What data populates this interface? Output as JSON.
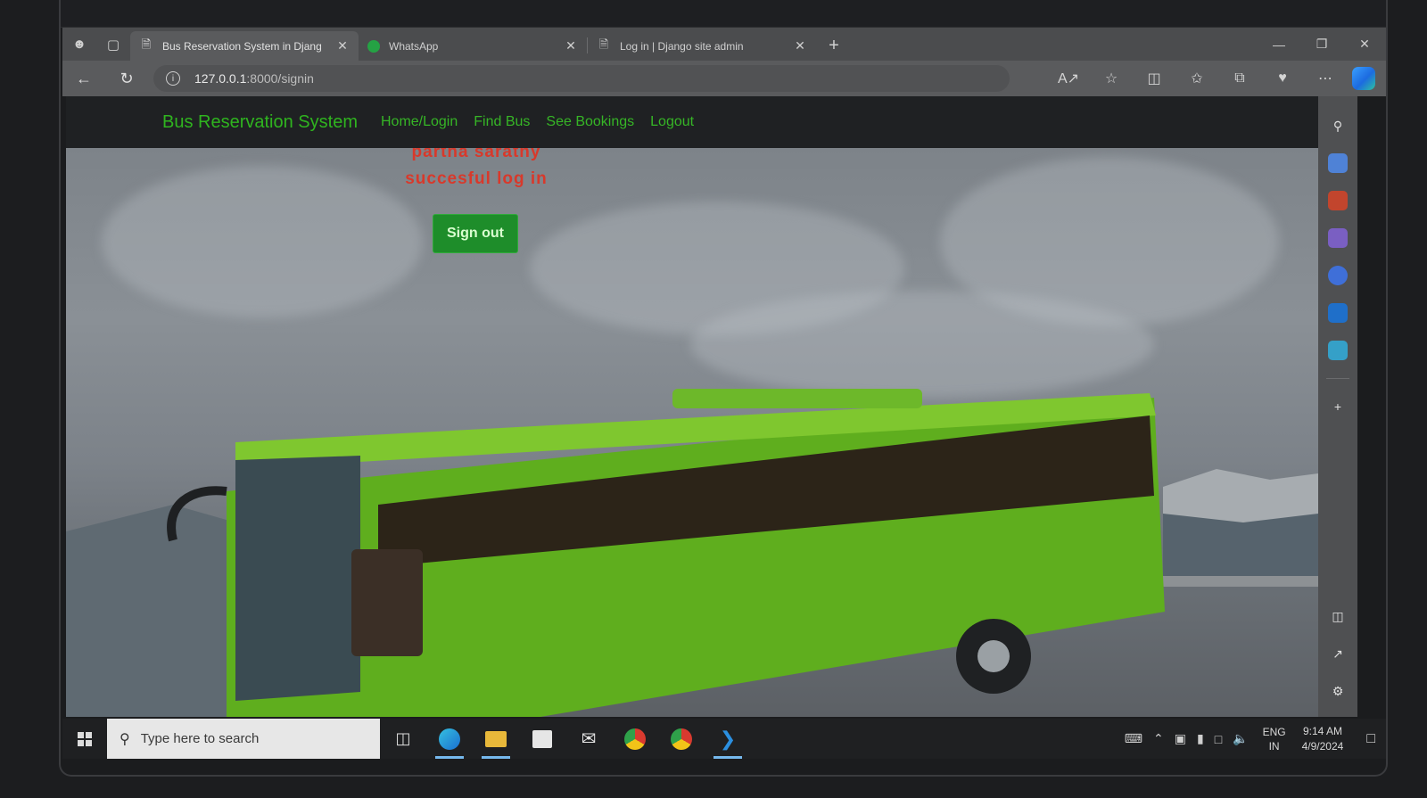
{
  "browser": {
    "tabs": [
      {
        "title": "Bus Reservation System in Djang",
        "favicon": "page-icon",
        "active": true
      },
      {
        "title": "WhatsApp",
        "favicon": "whatsapp-icon",
        "active": false
      },
      {
        "title": "Log in | Django site admin",
        "favicon": "page-icon",
        "active": false
      }
    ],
    "url_host": "127.0.0.1",
    "url_path": ":8000/signin"
  },
  "site": {
    "brand": "Bus Reservation System",
    "nav": [
      "Home/Login",
      "Find Bus",
      "See Bookings",
      "Logout"
    ],
    "message_line1": "partha sarathy",
    "message_line2": "succesful log in",
    "signout_label": "Sign out"
  },
  "taskbar": {
    "search_placeholder": "Type here to search",
    "lang_line1": "ENG",
    "lang_line2": "IN",
    "time": "9:14 AM",
    "date": "4/9/2024"
  },
  "colors": {
    "brand_green": "#2fb41f",
    "message_red": "#d8392b",
    "button_green": "#1e8d2a",
    "bus_green": "#5fae1e"
  }
}
